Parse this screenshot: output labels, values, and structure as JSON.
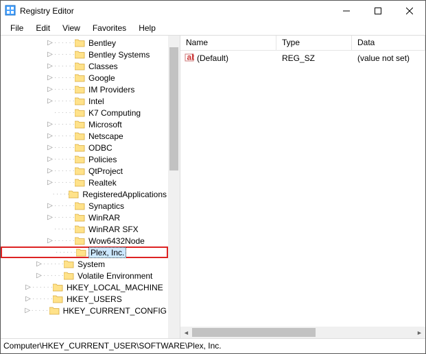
{
  "titlebar": {
    "title": "Registry Editor"
  },
  "menu": {
    "file": "File",
    "edit": "Edit",
    "view": "View",
    "favorites": "Favorites",
    "help": "Help"
  },
  "columns": {
    "name": "Name",
    "type": "Type",
    "data": "Data"
  },
  "value_row": {
    "name": "(Default)",
    "type": "REG_SZ",
    "data": "(value not set)"
  },
  "statusbar": {
    "path": "Computer\\HKEY_CURRENT_USER\\SOFTWARE\\Plex, Inc."
  },
  "tree": {
    "software_children": [
      {
        "label": "Bentley",
        "expandable": true
      },
      {
        "label": "Bentley Systems",
        "expandable": true
      },
      {
        "label": "Classes",
        "expandable": true
      },
      {
        "label": "Google",
        "expandable": true
      },
      {
        "label": "IM Providers",
        "expandable": true
      },
      {
        "label": "Intel",
        "expandable": true
      },
      {
        "label": "K7 Computing",
        "expandable": false
      },
      {
        "label": "Microsoft",
        "expandable": true
      },
      {
        "label": "Netscape",
        "expandable": true
      },
      {
        "label": "ODBC",
        "expandable": true
      },
      {
        "label": "Policies",
        "expandable": true
      },
      {
        "label": "QtProject",
        "expandable": true
      },
      {
        "label": "Realtek",
        "expandable": true
      },
      {
        "label": "RegisteredApplications",
        "expandable": false
      },
      {
        "label": "Synaptics",
        "expandable": true
      },
      {
        "label": "WinRAR",
        "expandable": true
      },
      {
        "label": "WinRAR SFX",
        "expandable": false
      },
      {
        "label": "Wow6432Node",
        "expandable": true
      },
      {
        "label": "Plex, Inc.",
        "expandable": false,
        "selected": true
      }
    ],
    "siblings_after": [
      {
        "label": "System",
        "indent": 3,
        "expandable": true
      },
      {
        "label": "Volatile Environment",
        "indent": 3,
        "expandable": true
      },
      {
        "label": "HKEY_LOCAL_MACHINE",
        "indent": 2,
        "expandable": true
      },
      {
        "label": "HKEY_USERS",
        "indent": 2,
        "expandable": true
      },
      {
        "label": "HKEY_CURRENT_CONFIG",
        "indent": 2,
        "expandable": true
      }
    ]
  }
}
